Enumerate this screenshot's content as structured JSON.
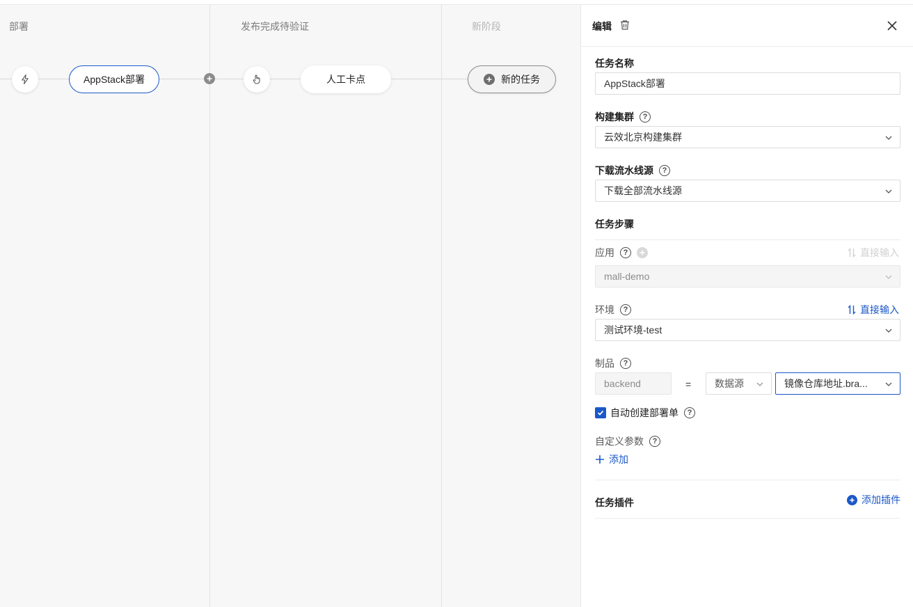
{
  "pipeline": {
    "stages": [
      {
        "title": "部署"
      },
      {
        "title": "发布完成待验证"
      },
      {
        "title": "新阶段"
      }
    ],
    "tasks": {
      "deploy": "AppStack部署",
      "manual": "人工卡点",
      "new_task": "新的任务"
    }
  },
  "panel": {
    "title": "编辑",
    "task_name": {
      "label": "任务名称",
      "value": "AppStack部署"
    },
    "build_cluster": {
      "label": "构建集群",
      "value": "云效北京构建集群"
    },
    "download_source": {
      "label": "下载流水线源",
      "value": "下载全部流水线源"
    },
    "steps_title": "任务步骤",
    "app": {
      "label": "应用",
      "value": "mall-demo",
      "direct_input": "直接输入"
    },
    "env": {
      "label": "环境",
      "value": "测试环境-test",
      "direct_input": "直接输入"
    },
    "artifact": {
      "label": "制品",
      "name": "backend",
      "equals": "=",
      "source": "数据源",
      "value": "镜像仓库地址.bra..."
    },
    "auto_create": {
      "label": "自动创建部署单",
      "checked": true
    },
    "custom_params": {
      "label": "自定义参数",
      "add": "添加"
    },
    "plugins": {
      "label": "任务插件",
      "add": "添加插件"
    }
  },
  "colors": {
    "accent": "#1b58c8",
    "canvas": "#f7f7f7"
  }
}
